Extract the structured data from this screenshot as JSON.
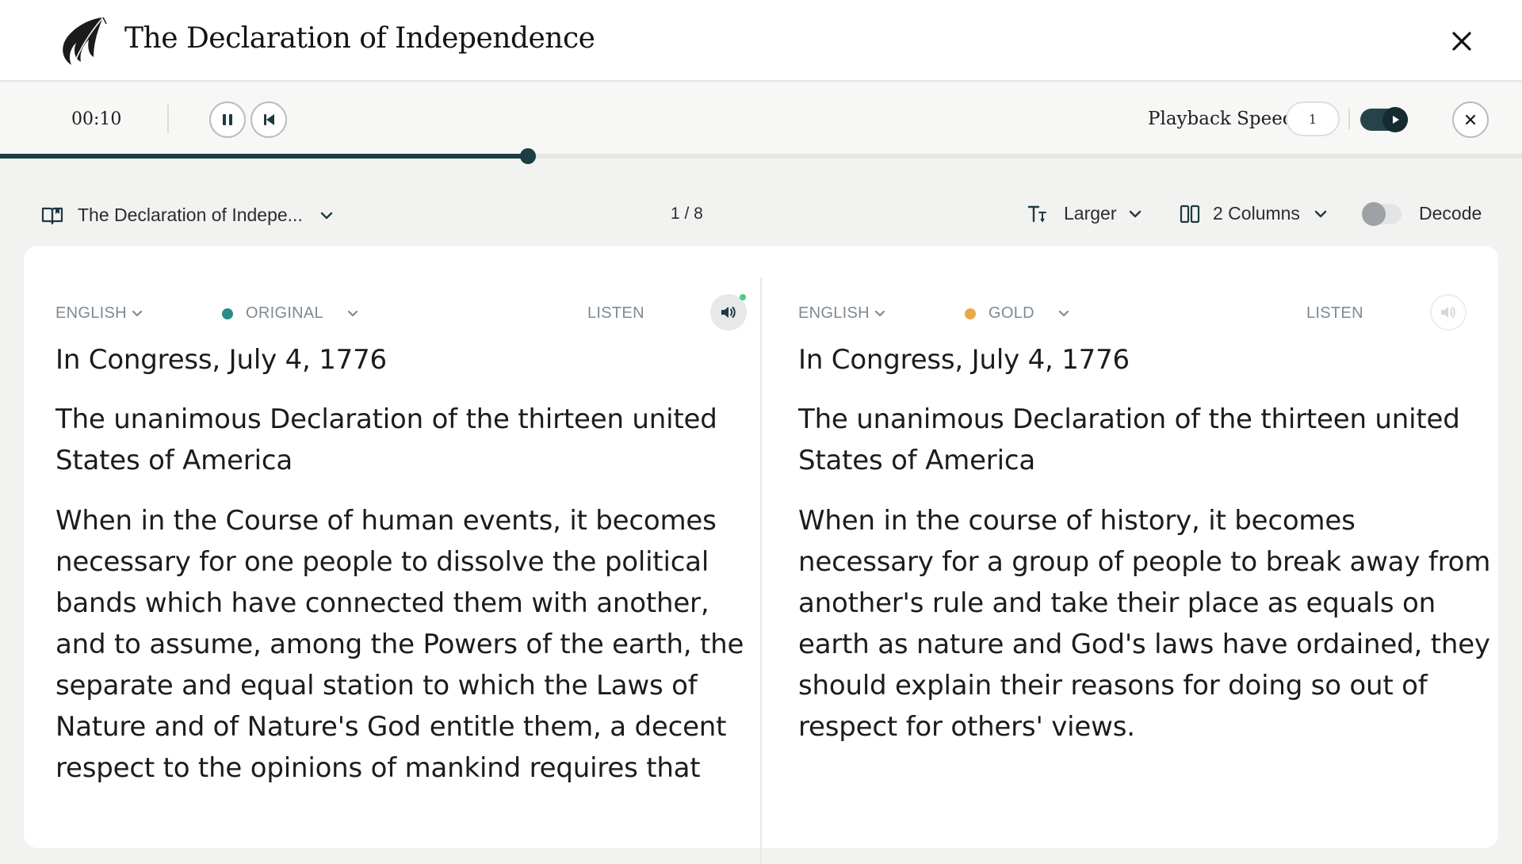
{
  "header": {
    "title": "The Declaration of Independence",
    "logo_icon": "quill-feather-logo",
    "close_icon": "close-icon"
  },
  "player": {
    "time": "00:10",
    "pause_icon": "pause-icon",
    "restart_icon": "skip-back-icon",
    "speed_label": "Playback Speed",
    "speed_value": "1",
    "autoplay_on": true,
    "progress_fraction": 0.347,
    "accent_color": "#1c3d42"
  },
  "toolbar": {
    "book_icon": "book-icon",
    "book_title": "The Declaration of Indepe...",
    "page_indicator": "1 / 8",
    "text_size_icon": "text-size-icon",
    "text_size": "Larger",
    "columns_icon": "columns-icon",
    "columns": "2 Columns",
    "decode_label": "Decode",
    "decode_on": false
  },
  "columns": [
    {
      "language": "ENGLISH",
      "version": "ORIGINAL",
      "version_color": "#2e8b87",
      "listen_label": "LISTEN",
      "listen_active": true,
      "paragraphs": [
        "In Congress, July 4, 1776",
        "The unanimous Declaration of the thirteen united States of America",
        "When in the Course of human events, it becomes necessary for one people to dissolve the political bands which have connected them with another, and to assume, among the Powers of the earth, the separate and equal station to which the Laws of Nature and of Nature's God entitle them, a decent respect to the opinions of mankind requires that"
      ]
    },
    {
      "language": "ENGLISH",
      "version": "GOLD",
      "version_color": "#e8a94a",
      "listen_label": "LISTEN",
      "listen_active": false,
      "paragraphs": [
        "In Congress, July 4, 1776",
        "The unanimous Declaration of the thirteen united States of America",
        "When in the course of history, it becomes necessary for a group of people to break away from another's rule and take their place as equals on earth as nature and God's laws have ordained, they should explain their reasons for doing so out of respect for others' views."
      ]
    }
  ]
}
